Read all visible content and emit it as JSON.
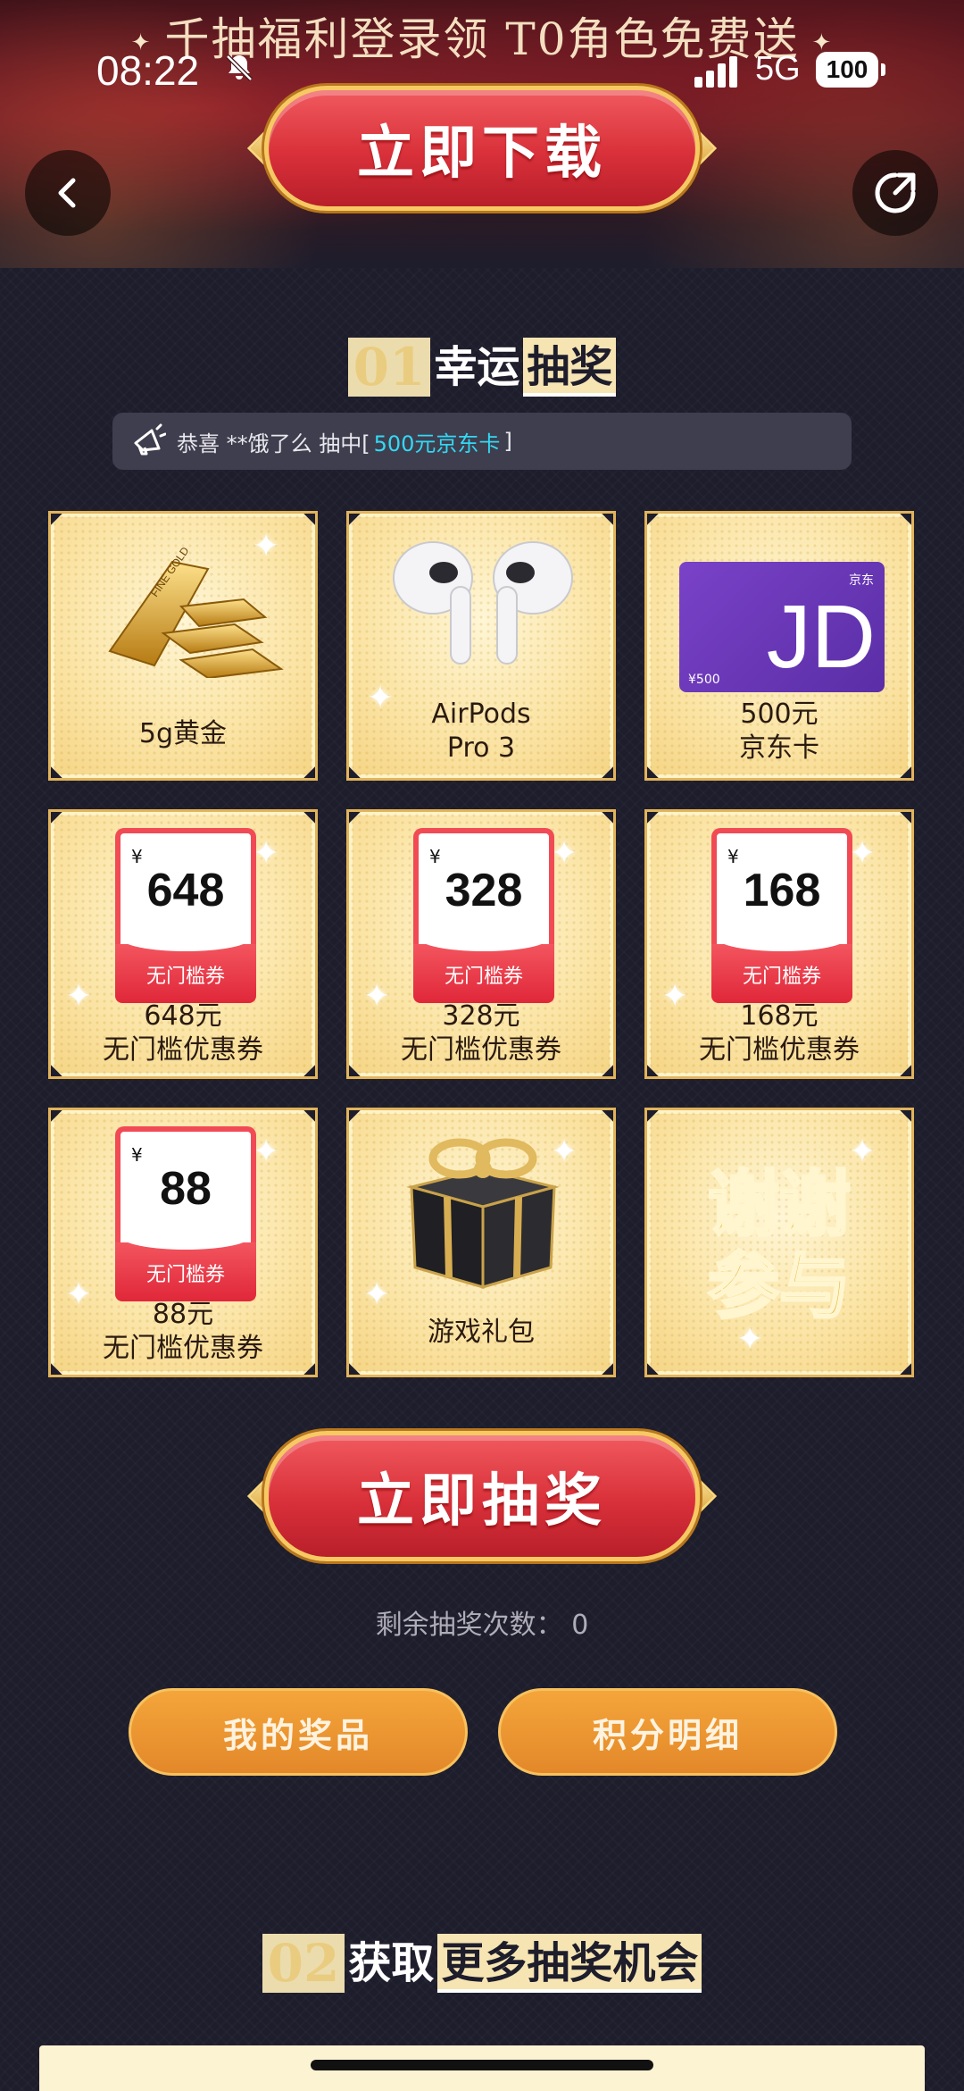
{
  "banner": {
    "title": "千抽福利登录领 T0角色免费送"
  },
  "status": {
    "time": "08:22",
    "network": "5G",
    "battery": "100"
  },
  "header": {
    "download_label": "立即下载"
  },
  "section1": {
    "num": "01",
    "lead": "幸运",
    "tail": "抽奖"
  },
  "notice": {
    "prefix": "恭喜 **饿了么 抽中[ ",
    "prize": "500元京东卡",
    "suffix": " ]"
  },
  "prizes": [
    {
      "line1": "5g黄金",
      "line2": ""
    },
    {
      "line1": "AirPods",
      "line2": "Pro 3"
    },
    {
      "line1": "500元",
      "line2": "京东卡",
      "card_value": "¥500",
      "card_brand": "京东"
    },
    {
      "line1": "648元",
      "line2": "无门槛优惠券",
      "coupon_yen": "¥",
      "coupon_amount": "648",
      "coupon_tag": "无门槛券"
    },
    {
      "line1": "328元",
      "line2": "无门槛优惠券",
      "coupon_yen": "¥",
      "coupon_amount": "328",
      "coupon_tag": "无门槛券"
    },
    {
      "line1": "168元",
      "line2": "无门槛优惠券",
      "coupon_yen": "¥",
      "coupon_amount": "168",
      "coupon_tag": "无门槛券"
    },
    {
      "line1": "88元",
      "line2": "无门槛优惠券",
      "coupon_yen": "¥",
      "coupon_amount": "88",
      "coupon_tag": "无门槛券"
    },
    {
      "line1": "游戏礼包",
      "line2": ""
    },
    {
      "big1": "谢谢",
      "big2": "参与"
    }
  ],
  "draw_label": "立即抽奖",
  "remaining": "剩余抽奖次数：  0",
  "buttons": {
    "my_prizes": "我的奖品",
    "points_detail": "积分明细"
  },
  "section2": {
    "num": "02",
    "lead": "获取",
    "tail": "更多抽奖机会"
  },
  "colors": {
    "accent_red": "#d9303a",
    "gold": "#f7c963",
    "orange": "#e3882a",
    "highlight": "#32d9f5"
  }
}
